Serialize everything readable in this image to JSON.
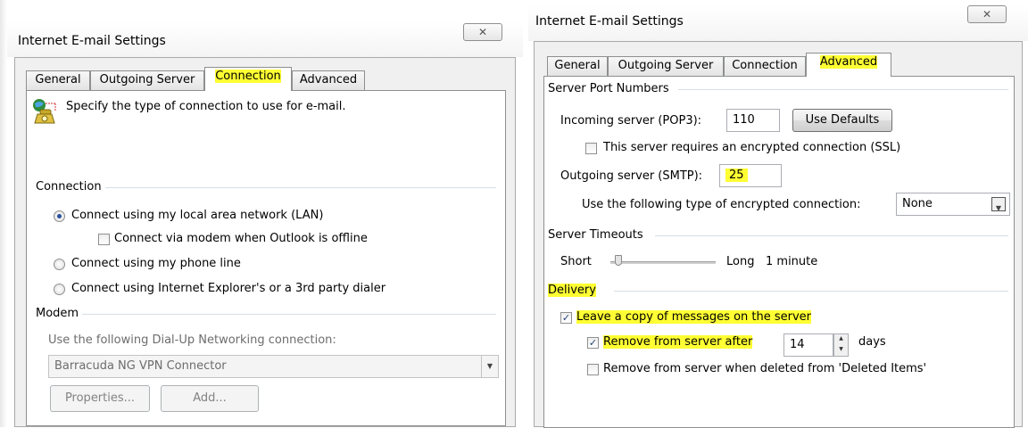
{
  "left": {
    "title": "Internet E-mail Settings",
    "close_glyph": "✕",
    "tabs": [
      {
        "label": "General"
      },
      {
        "label": "Outgoing Server"
      },
      {
        "label": "Connection"
      },
      {
        "label": "Advanced"
      }
    ],
    "active_tab": "Connection",
    "intro": "Specify the type of connection to use for e-mail.",
    "connection": {
      "heading": "Connection",
      "options": [
        {
          "label": "Connect using my local area network (LAN)",
          "selected": true
        },
        {
          "label": "Connect using my phone line",
          "selected": false
        },
        {
          "label": "Connect using Internet Explorer's or a 3rd party dialer",
          "selected": false
        }
      ],
      "modem_offline_label": "Connect via modem when Outlook is offline",
      "modem_offline_checked": false
    },
    "modem": {
      "heading": "Modem",
      "dialup_label": "Use the following Dial-Up Networking connection:",
      "dialup_value": "Barracuda NG VPN Connector",
      "properties_label": "Properties...",
      "add_label": "Add..."
    }
  },
  "right": {
    "title": "Internet E-mail Settings",
    "close_glyph": "✕",
    "tabs": [
      {
        "label": "General"
      },
      {
        "label": "Outgoing Server"
      },
      {
        "label": "Connection"
      },
      {
        "label": "Advanced"
      }
    ],
    "active_tab": "Advanced",
    "ports": {
      "heading": "Server Port Numbers",
      "incoming_label": "Incoming server (POP3):",
      "incoming_value": "110",
      "use_defaults_label": "Use Defaults",
      "ssl_label": "This server requires an encrypted connection (SSL)",
      "ssl_checked": false,
      "outgoing_label": "Outgoing server (SMTP):",
      "outgoing_value": "25",
      "encryption_label": "Use the following type of encrypted connection:",
      "encryption_value": "None"
    },
    "timeouts": {
      "heading": "Server Timeouts",
      "short_label": "Short",
      "long_label": "Long",
      "value_label": "1 minute",
      "slider_position": 0.08
    },
    "delivery": {
      "heading": "Delivery",
      "leave_copy_label": "Leave a copy of messages on the server",
      "leave_copy_checked": true,
      "remove_after_label": "Remove from server after",
      "remove_after_checked": true,
      "remove_after_days": "14",
      "days_label": "days",
      "remove_deleted_label": "Remove from server when deleted from 'Deleted Items'",
      "remove_deleted_checked": false
    }
  },
  "colors": {
    "highlight": "#ffff33",
    "frame": "#f0f0f0",
    "radio_dot": "#2a4f9a"
  }
}
